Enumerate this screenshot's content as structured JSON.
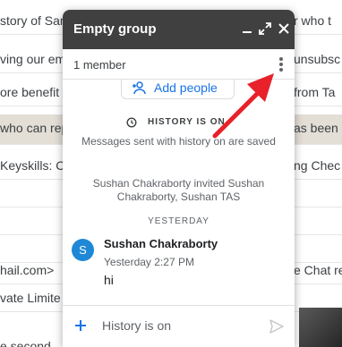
{
  "background": {
    "rows": [
      {
        "left": "story of Sand",
        "right": "r who t",
        "shaded": false
      },
      {
        "left": "ving our eme",
        "right": "unsubsc",
        "shaded": false
      },
      {
        "left": "ore benefit",
        "right": "from Ta",
        "shaded": false
      },
      {
        "left": "who can rep",
        "right": "as been p",
        "shaded": true
      },
      {
        "left": "Keyskills: C",
        "right": "ng Chec",
        "shaded": false
      },
      {
        "left": "",
        "right": "",
        "shaded": false
      },
      {
        "left": "",
        "right": "",
        "shaded": false
      },
      {
        "left": "",
        "right": "",
        "shaded": false
      },
      {
        "left": "",
        "right": "",
        "shaded": false
      },
      {
        "left": "hail.com>",
        "right": "e Chat re",
        "shaded": false
      },
      {
        "left": "vate Limite",
        "right": "",
        "shaded": false
      },
      {
        "left": "e second",
        "right": "",
        "shaded": false
      }
    ]
  },
  "chat": {
    "title": "Empty group",
    "member_count": "1 member",
    "add_people_label": "Add people",
    "history_title": "HISTORY IS ON",
    "history_description": "Messages sent with history on are saved",
    "system_message": "Sushan Chakraborty invited Sushan Chakraborty, Sushan TAS",
    "day_separator": "YESTERDAY",
    "message": {
      "avatar_initial": "S",
      "sender": "Sushan Chakraborty",
      "timestamp": "Yesterday 2:27 PM",
      "text": "hi"
    },
    "compose_placeholder": "History is on"
  },
  "colors": {
    "header_bg": "#404040",
    "accent_blue": "#1a73e8",
    "avatar_blue": "#1e88d6",
    "arrow_red": "#e8212b"
  }
}
